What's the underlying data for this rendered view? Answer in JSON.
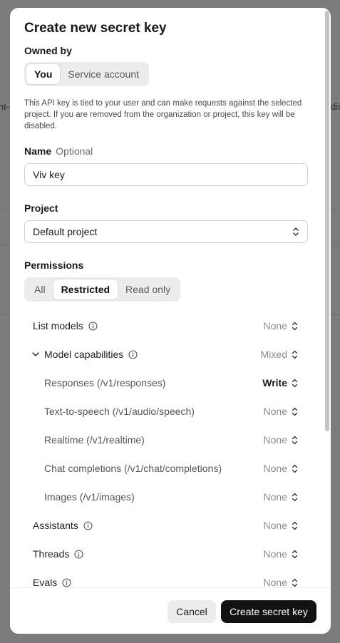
{
  "background": {
    "left_fragment": "nt-",
    "right_fragment": "dis"
  },
  "modal": {
    "title": "Create new secret key",
    "owned_by": {
      "label": "Owned by",
      "options": [
        "You",
        "Service account"
      ],
      "selected": "You"
    },
    "description": "This API key is tied to your user and can make requests against the selected project. If you are removed from the organization or project, this key will be disabled.",
    "name_field": {
      "label": "Name",
      "optional_label": "Optional",
      "value": "Viv key"
    },
    "project_field": {
      "label": "Project",
      "value": "Default project"
    },
    "permissions": {
      "label": "Permissions",
      "options": [
        "All",
        "Restricted",
        "Read only"
      ],
      "selected": "Restricted",
      "rows": [
        {
          "label": "List models",
          "value": "None",
          "info": true
        },
        {
          "label": "Model capabilities",
          "value": "Mixed",
          "info": true,
          "expanded": true
        },
        {
          "label": "Responses (/v1/responses)",
          "value": "Write",
          "sub": true
        },
        {
          "label": "Text-to-speech (/v1/audio/speech)",
          "value": "None",
          "sub": true
        },
        {
          "label": "Realtime (/v1/realtime)",
          "value": "None",
          "sub": true
        },
        {
          "label": "Chat completions (/v1/chat/completions)",
          "value": "None",
          "sub": true
        },
        {
          "label": "Images (/v1/images)",
          "value": "None",
          "sub": true
        },
        {
          "label": "Assistants",
          "value": "None",
          "info": true
        },
        {
          "label": "Threads",
          "value": "None",
          "info": true
        },
        {
          "label": "Evals",
          "value": "None",
          "info": true
        }
      ]
    },
    "footer": {
      "cancel_label": "Cancel",
      "create_label": "Create secret key"
    }
  }
}
